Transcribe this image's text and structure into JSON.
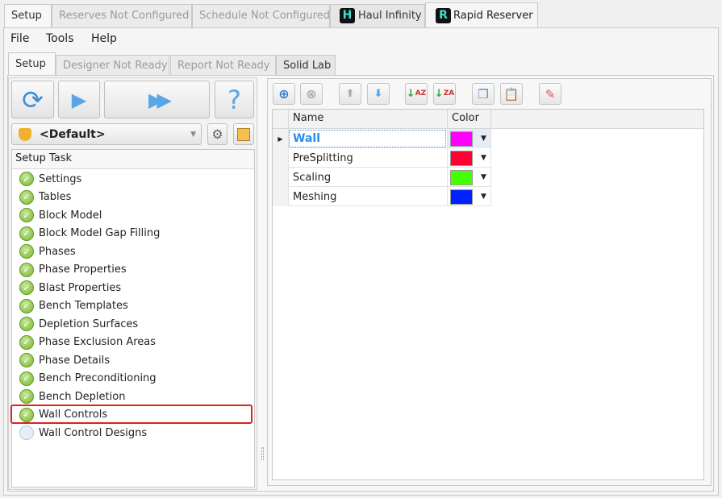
{
  "top_tabs": [
    {
      "label": "Setup"
    },
    {
      "label": "Reserves Not Configured"
    },
    {
      "label": "Schedule Not Configured"
    },
    {
      "label": "Haul Infinity"
    },
    {
      "label": "Rapid Reserver"
    }
  ],
  "menu": [
    "File",
    "Tools",
    "Help"
  ],
  "inner_tabs": [
    {
      "label": "Setup"
    },
    {
      "label": "Designer Not Ready"
    },
    {
      "label": "Report Not Ready"
    },
    {
      "label": "Solid Lab"
    }
  ],
  "profile": {
    "value": "<Default>"
  },
  "task_list": {
    "header": "Setup Task",
    "items": [
      {
        "label": "Settings",
        "done": true
      },
      {
        "label": "Tables",
        "done": true
      },
      {
        "label": "Block Model",
        "done": true
      },
      {
        "label": "Block Model Gap Filling",
        "done": true
      },
      {
        "label": "Phases",
        "done": true
      },
      {
        "label": "Phase Properties",
        "done": true
      },
      {
        "label": "Blast Properties",
        "done": true
      },
      {
        "label": "Bench Templates",
        "done": true
      },
      {
        "label": "Depletion Surfaces",
        "done": true
      },
      {
        "label": "Phase Exclusion Areas",
        "done": true
      },
      {
        "label": "Phase Details",
        "done": true
      },
      {
        "label": "Bench Preconditioning",
        "done": true
      },
      {
        "label": "Bench Depletion",
        "done": true
      },
      {
        "label": "Wall Controls",
        "done": true,
        "selected": true
      },
      {
        "label": "Wall Control Designs",
        "done": false
      }
    ]
  },
  "grid": {
    "columns": [
      "Name",
      "Color"
    ],
    "rows": [
      {
        "name": "Wall",
        "color": "#ff00ff"
      },
      {
        "name": "PreSplitting",
        "color": "#ff0033"
      },
      {
        "name": "Scaling",
        "color": "#44ff00"
      },
      {
        "name": "Meshing",
        "color": "#0022ff"
      }
    ]
  },
  "icons": {
    "sort_az": "AZ",
    "sort_za": "ZA",
    "help": "?"
  }
}
